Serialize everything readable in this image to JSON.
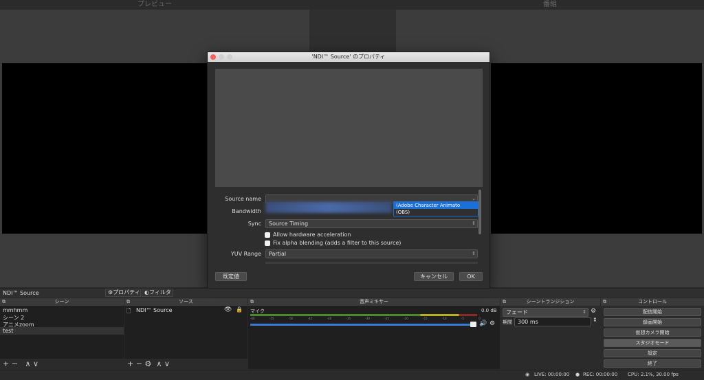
{
  "preview": {
    "title": "プレビュー"
  },
  "program": {
    "title": "番組"
  },
  "dialog": {
    "title": "'NDI™ Source' のプロパティ",
    "fields": {
      "source_name": {
        "label": "Source name",
        "value": ""
      },
      "bandwidth": {
        "label": "Bandwidth",
        "value": ""
      },
      "sync": {
        "label": "Sync",
        "value": "Source Timing"
      },
      "hw_accel": {
        "label": "Allow hardware acceleration",
        "checked": false
      },
      "alpha_fix": {
        "label": "Fix alpha blending (adds a filter to this source)",
        "checked": false
      },
      "yuv_range": {
        "label": "YUV Range",
        "value": "Partial"
      }
    },
    "dropdown_options": [
      "(Adobe Character Animato",
      "(OBS)"
    ],
    "buttons": {
      "defaults": "既定値",
      "cancel": "キャンセル",
      "ok": "OK"
    }
  },
  "source_bar": {
    "selected": "NDI™ Source",
    "properties": "プロパティ",
    "filters": "フィルタ"
  },
  "scenes": {
    "title": "シーン",
    "items": [
      "mmhmm",
      "シーン 2",
      "アニメzoom",
      "test"
    ]
  },
  "sources": {
    "title": "ソース",
    "items": [
      "NDI™ Source"
    ]
  },
  "mixer": {
    "title": "音声ミキサー",
    "channel": "マイク",
    "level": "0.0 dB",
    "ticks": [
      "-60",
      "-55",
      "-50",
      "-45",
      "-40",
      "-35",
      "-30",
      "-25",
      "-20",
      "-15",
      "-10",
      "-5",
      "0"
    ]
  },
  "transitions": {
    "title": "シーントランジション",
    "type": "フェード",
    "duration_label": "期間",
    "duration": "300 ms"
  },
  "controls": {
    "title": "コントロール",
    "buttons": [
      "配信開始",
      "録画開始",
      "仮想カメラ開始",
      "スタジオモード",
      "設定",
      "終了"
    ]
  },
  "status": {
    "live": "LIVE: 00:00:00",
    "rec": "REC: 00:00:00",
    "cpu": "CPU: 2.1%, 30.00 fps"
  },
  "colors": {
    "accent": "#1b6fd8",
    "meter_green": "#4a8a2a",
    "meter_yellow": "#b8b020",
    "slider_blue": "#3b7bd8"
  }
}
